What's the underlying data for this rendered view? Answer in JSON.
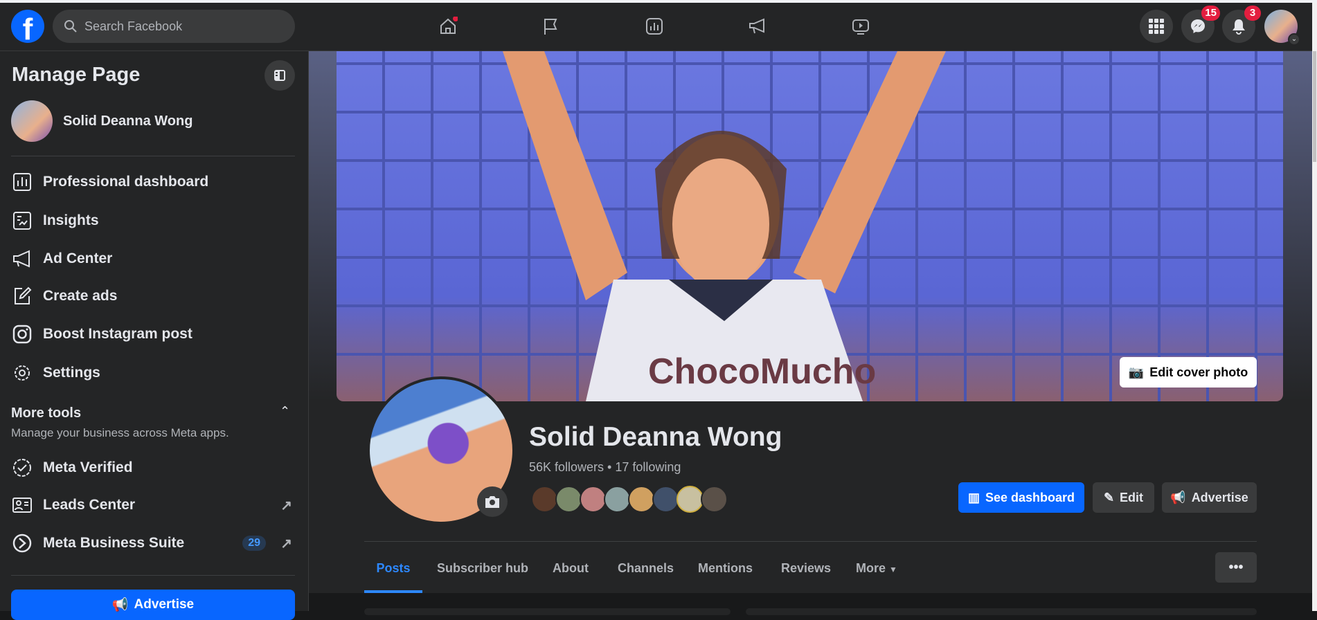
{
  "header": {
    "search_placeholder": "Search Facebook",
    "messenger_badge": "15",
    "notifications_badge": "3",
    "nav_icons": [
      "home-icon",
      "flag-icon",
      "insights-icon",
      "megaphone-icon",
      "video-icon"
    ]
  },
  "sidebar": {
    "title": "Manage Page",
    "page_name": "Solid Deanna Wong",
    "items": [
      {
        "label": "Professional dashboard"
      },
      {
        "label": "Insights"
      },
      {
        "label": "Ad Center"
      },
      {
        "label": "Create ads"
      },
      {
        "label": "Boost Instagram post"
      },
      {
        "label": "Settings"
      }
    ],
    "more_tools": {
      "title": "More tools",
      "subtitle": "Manage your business across Meta apps.",
      "items": [
        {
          "label": "Meta Verified"
        },
        {
          "label": "Leads Center"
        },
        {
          "label": "Meta Business Suite",
          "count": "29"
        }
      ]
    },
    "advertise": "Advertise"
  },
  "profile": {
    "edit_cover": "Edit cover photo",
    "name": "Solid Deanna Wong",
    "stats": "56K followers • 17 following",
    "buttons": {
      "dashboard": "See dashboard",
      "edit": "Edit",
      "advertise": "Advertise"
    }
  },
  "tabs": [
    "Posts",
    "Subscriber hub",
    "About",
    "Channels",
    "Mentions",
    "Reviews",
    "More"
  ],
  "more_menu": "•••",
  "colors": {
    "accent": "#0866ff",
    "badge": "#e41e3f"
  }
}
